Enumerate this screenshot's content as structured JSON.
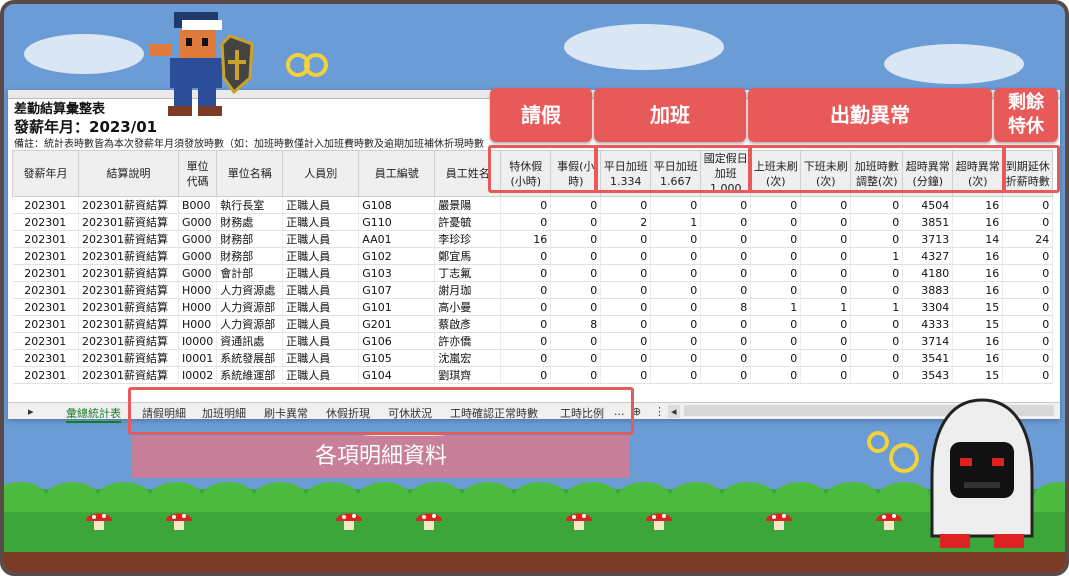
{
  "sheet": {
    "title": "差勤結算彙整表",
    "pay_month": "發薪年月：2023/01",
    "note": "備註：統計表時數皆為本次發薪年月須發放時數（如：加班時數僅計入加班費時數及逾期加班補休折現時數"
  },
  "headers": [
    "發薪年月",
    "結算說明",
    "單位\n代碼",
    "單位名稱",
    "人員別",
    "員工編號",
    "員工姓名",
    "特休假\n(小時)",
    "事假(小\n時)",
    "平日加班\n1.334",
    "平日加班\n1.667",
    "國定假日\n加班\n1.000",
    "上班未刷\n(次)",
    "下班未刷\n(次)",
    "加班時數\n調整(次)",
    "超時異常\n(分鐘)",
    "超時異常\n(次)",
    "到期延休\n折薪時數"
  ],
  "rows": [
    [
      "202301",
      "202301薪資結算",
      "B000",
      "執行長室",
      "正職人員",
      "G108",
      "嚴景陽",
      "0",
      "0",
      "0",
      "0",
      "0",
      "0",
      "0",
      "0",
      "4504",
      "16",
      "0"
    ],
    [
      "202301",
      "202301薪資結算",
      "G000",
      "財務處",
      "正職人員",
      "G110",
      "許憂毓",
      "0",
      "0",
      "2",
      "1",
      "0",
      "0",
      "0",
      "0",
      "3851",
      "16",
      "0"
    ],
    [
      "202301",
      "202301薪資結算",
      "G000",
      "財務部",
      "正職人員",
      "AA01",
      "李珍珍",
      "16",
      "0",
      "0",
      "0",
      "0",
      "0",
      "0",
      "0",
      "3713",
      "14",
      "24"
    ],
    [
      "202301",
      "202301薪資結算",
      "G000",
      "財務部",
      "正職人員",
      "G102",
      "鄭宜馬",
      "0",
      "0",
      "0",
      "0",
      "0",
      "0",
      "0",
      "1",
      "4327",
      "16",
      "0"
    ],
    [
      "202301",
      "202301薪資結算",
      "G000",
      "會計部",
      "正職人員",
      "G103",
      "丁志氟",
      "0",
      "0",
      "0",
      "0",
      "0",
      "0",
      "0",
      "0",
      "4180",
      "16",
      "0"
    ],
    [
      "202301",
      "202301薪資結算",
      "H000",
      "人力資源處",
      "正職人員",
      "G107",
      "謝月珈",
      "0",
      "0",
      "0",
      "0",
      "0",
      "0",
      "0",
      "0",
      "3883",
      "16",
      "0"
    ],
    [
      "202301",
      "202301薪資結算",
      "H000",
      "人力資源部",
      "正職人員",
      "G101",
      "高小曼",
      "0",
      "0",
      "0",
      "0",
      "8",
      "1",
      "1",
      "1",
      "3304",
      "15",
      "0"
    ],
    [
      "202301",
      "202301薪資結算",
      "H000",
      "人力資源部",
      "正職人員",
      "G201",
      "蔡啟彥",
      "0",
      "8",
      "0",
      "0",
      "0",
      "0",
      "0",
      "0",
      "4333",
      "15",
      "0"
    ],
    [
      "202301",
      "202301薪資結算",
      "I0000",
      "資通訊處",
      "正職人員",
      "G106",
      "許亦僑",
      "0",
      "0",
      "0",
      "0",
      "0",
      "0",
      "0",
      "0",
      "3714",
      "16",
      "0"
    ],
    [
      "202301",
      "202301薪資結算",
      "I0001",
      "系統發展部",
      "正職人員",
      "G105",
      "沈嵐宏",
      "0",
      "0",
      "0",
      "0",
      "0",
      "0",
      "0",
      "0",
      "3541",
      "16",
      "0"
    ],
    [
      "202301",
      "202301薪資結算",
      "I0002",
      "系統維運部",
      "正職人員",
      "G104",
      "劉琪齊",
      "0",
      "0",
      "0",
      "0",
      "0",
      "0",
      "0",
      "0",
      "3543",
      "15",
      "0"
    ]
  ],
  "tabs": [
    "彙總統計表",
    "請假明細",
    "加班明細",
    "刷卡異常",
    "休假折現",
    "可休狀況",
    "工時確認正常時數",
    "工時比例",
    "..."
  ],
  "banners": {
    "leave": "請假",
    "overtime": "加班",
    "attendance": "出勤異常",
    "remaining": "剩餘\n特休"
  },
  "caption": "各項明細資料",
  "colors": {
    "accent": "#e85a5a",
    "sky": "#6b9cd6",
    "caption_bg": "#c87f9a",
    "grass": "#3da63a"
  }
}
